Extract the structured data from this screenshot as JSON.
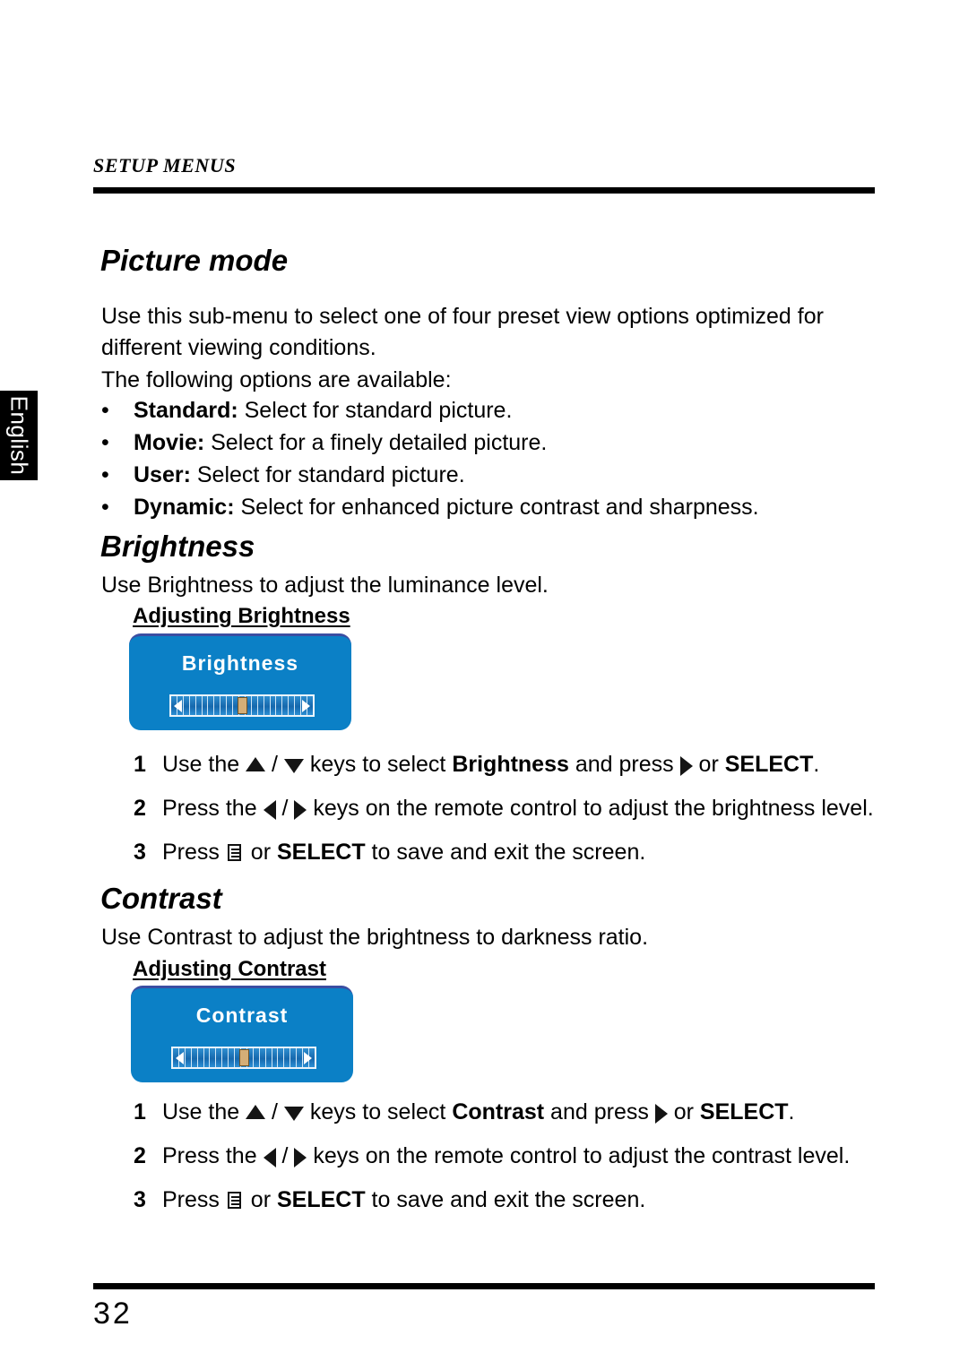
{
  "document": {
    "running_head": "SETUP MENUS",
    "page_number": "32",
    "language_tab": "English"
  },
  "sections": [
    {
      "id": "picture-mode",
      "title": "Picture mode",
      "intro": "Use this sub-menu to select one of four preset view options optimized for different viewing conditions.",
      "list_intro": "The following options are available:",
      "bullet_marker": "•",
      "options": [
        {
          "term": "Standard:",
          "desc": " Select for standard picture."
        },
        {
          "term": "Movie:",
          "desc": " Select for a finely detailed picture."
        },
        {
          "term": "User:",
          "desc": " Select for standard picture."
        },
        {
          "term": "Dynamic:",
          "desc": " Select for enhanced picture contrast and sharpness."
        }
      ]
    },
    {
      "id": "brightness",
      "title": "Brightness",
      "intro": "Use Brightness to adjust the luminance level.",
      "sub_head": "Adjusting Brightness",
      "osd": {
        "title": "Brightness",
        "slider_ticks": 23,
        "slider_value_percent": 50,
        "left_arrow_icon": "triangle-left-icon",
        "right_arrow_icon": "triangle-right-icon",
        "box_color": "#0b80c6",
        "thumb_color": "#d4ae77"
      },
      "steps": [
        {
          "num": "1",
          "parts": [
            {
              "t": "text",
              "v": "Use the "
            },
            {
              "t": "icon",
              "v": "tri-up"
            },
            {
              "t": "text",
              "v": " / "
            },
            {
              "t": "icon",
              "v": "tri-down"
            },
            {
              "t": "text",
              "v": " keys to select "
            },
            {
              "t": "bold",
              "v": "Brightness"
            },
            {
              "t": "text",
              "v": " and press "
            },
            {
              "t": "icon",
              "v": "tri-right"
            },
            {
              "t": "text",
              "v": " or "
            },
            {
              "t": "bold",
              "v": "SELECT"
            },
            {
              "t": "text",
              "v": "."
            }
          ]
        },
        {
          "num": "2",
          "parts": [
            {
              "t": "text",
              "v": "Press the "
            },
            {
              "t": "icon",
              "v": "tri-left"
            },
            {
              "t": "text",
              "v": " / "
            },
            {
              "t": "icon",
              "v": "tri-right"
            },
            {
              "t": "text",
              "v": " keys on the remote control to adjust the brightness level."
            }
          ]
        },
        {
          "num": "3",
          "parts": [
            {
              "t": "text",
              "v": "Press "
            },
            {
              "t": "icon",
              "v": "menu"
            },
            {
              "t": "text",
              "v": " or "
            },
            {
              "t": "bold",
              "v": "SELECT"
            },
            {
              "t": "text",
              "v": " to save and exit the screen."
            }
          ]
        }
      ]
    },
    {
      "id": "contrast",
      "title": "Contrast",
      "intro": "Use Contrast to adjust the brightness to darkness ratio.",
      "sub_head": "Adjusting Contrast",
      "osd": {
        "title": "Contrast",
        "slider_ticks": 23,
        "slider_value_percent": 50,
        "left_arrow_icon": "triangle-left-icon",
        "right_arrow_icon": "triangle-right-icon",
        "box_color": "#0b80c6",
        "thumb_color": "#d4ae77"
      },
      "steps": [
        {
          "num": "1",
          "parts": [
            {
              "t": "text",
              "v": "Use the "
            },
            {
              "t": "icon",
              "v": "tri-up"
            },
            {
              "t": "text",
              "v": " / "
            },
            {
              "t": "icon",
              "v": "tri-down"
            },
            {
              "t": "text",
              "v": " keys to select "
            },
            {
              "t": "bold",
              "v": "Contrast"
            },
            {
              "t": "text",
              "v": " and press "
            },
            {
              "t": "icon",
              "v": "tri-right"
            },
            {
              "t": "text",
              "v": " or "
            },
            {
              "t": "bold",
              "v": "SELECT"
            },
            {
              "t": "text",
              "v": "."
            }
          ]
        },
        {
          "num": "2",
          "parts": [
            {
              "t": "text",
              "v": "Press the "
            },
            {
              "t": "icon",
              "v": "tri-left"
            },
            {
              "t": "text",
              "v": " / "
            },
            {
              "t": "icon",
              "v": "tri-right"
            },
            {
              "t": "text",
              "v": " keys on the remote control to adjust the contrast level."
            }
          ]
        },
        {
          "num": "3",
          "parts": [
            {
              "t": "text",
              "v": "Press "
            },
            {
              "t": "icon",
              "v": "menu"
            },
            {
              "t": "text",
              "v": " or "
            },
            {
              "t": "bold",
              "v": "SELECT"
            },
            {
              "t": "text",
              "v": " to save and exit the screen."
            }
          ]
        }
      ]
    }
  ]
}
